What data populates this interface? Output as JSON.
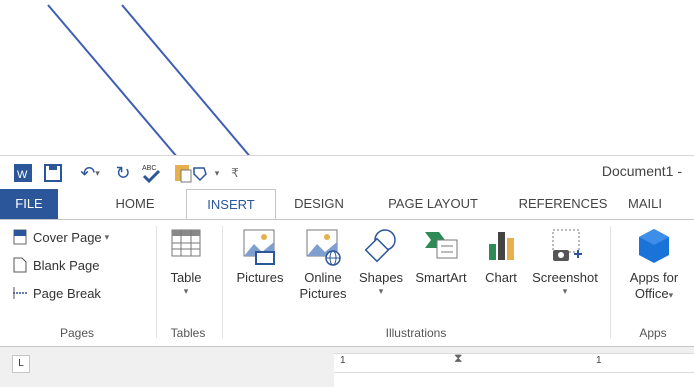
{
  "window_title": "Document1 -",
  "quick_access": {
    "word_icon": "word-logo-icon",
    "save_icon": "save-icon",
    "undo_icon": "undo-icon",
    "redo_icon": "redo-icon",
    "spelling_icon": "spelling-icon",
    "paste_icon": "paste-icon",
    "customize_icon": "customize-qat-icon",
    "undo_caret": "▾",
    "customize_caret": "▾"
  },
  "tabs": [
    {
      "label": "FILE"
    },
    {
      "label": "HOME"
    },
    {
      "label": "INSERT"
    },
    {
      "label": "DESIGN"
    },
    {
      "label": "PAGE LAYOUT"
    },
    {
      "label": "REFERENCES"
    },
    {
      "label": "MAILI"
    }
  ],
  "groups": {
    "pages": {
      "label": "Pages",
      "items": [
        {
          "label": "Cover Page",
          "caret": "▾"
        },
        {
          "label": "Blank Page"
        },
        {
          "label": "Page Break"
        }
      ]
    },
    "tables": {
      "label": "Tables",
      "table_label": "Table",
      "caret": "▾"
    },
    "illustrations": {
      "label": "Illustrations",
      "pictures": "Pictures",
      "online_line1": "Online",
      "online_line2": "Pictures",
      "shapes": "Shapes",
      "shapes_caret": "▾",
      "smartart": "SmartArt",
      "chart": "Chart",
      "screenshot": "Screenshot",
      "screenshot_caret": "▾"
    },
    "apps": {
      "label": "Apps",
      "line1": "Apps for",
      "line2": "Office",
      "caret": "▾"
    }
  },
  "ruler": {
    "corner": "L",
    "number": "1",
    "number2": "1"
  },
  "colors": {
    "accent": "#2b579a",
    "arrow": "#3f5fb5"
  }
}
